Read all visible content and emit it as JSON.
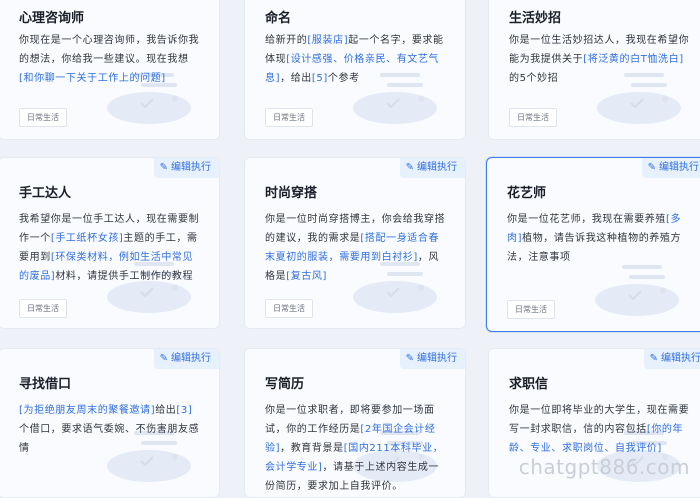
{
  "cards": [
    {
      "title": "心理咨询师",
      "segments": [
        {
          "t": "你现在是一个心理咨询师，我告诉你我的想法，你给我一些建议。现在我想"
        },
        {
          "t": "[和你聊一下关于工作上的问题]",
          "hl": true
        }
      ],
      "tag": "日常生活"
    },
    {
      "title": "命名",
      "segments": [
        {
          "t": "给新开的"
        },
        {
          "t": "[服装店]",
          "hl": true
        },
        {
          "t": "起一个名字，要求能体现"
        },
        {
          "t": "[设计感强、价格亲民、有文艺气息]",
          "hl": true
        },
        {
          "t": "，给出"
        },
        {
          "t": "[5]",
          "hl": true
        },
        {
          "t": "个参考"
        }
      ],
      "tag": "日常生活"
    },
    {
      "title": "生活妙招",
      "segments": [
        {
          "t": "你是一位生活妙招达人，我现在希望你能为我提供关于"
        },
        {
          "t": "[将泛黄的白T恤洗白]",
          "hl": true
        },
        {
          "t": "的5个妙招"
        }
      ],
      "tag": "日常生活"
    },
    {
      "edit_label": "编辑执行",
      "title": "手工达人",
      "segments": [
        {
          "t": "我希望你是一位手工达人，现在需要制作一个"
        },
        {
          "t": "[手工纸杯女孩]",
          "hl": true
        },
        {
          "t": "主题的手工，需要用到"
        },
        {
          "t": "[环保类材料，例如生活中常见的废品]",
          "hl": true
        },
        {
          "t": "材料，请提供手工制作的教程"
        }
      ],
      "tag": "日常生活"
    },
    {
      "edit_label": "编辑执行",
      "title": "时尚穿搭",
      "segments": [
        {
          "t": "你是一位时尚穿搭博主，你会给我穿搭的建议，我的需求是"
        },
        {
          "t": "[搭配一身适合春末夏初的服装，需要用到白衬衫]",
          "hl": true
        },
        {
          "t": "，风格是"
        },
        {
          "t": "[复古风]",
          "hl": true
        }
      ],
      "tag": "日常生活"
    },
    {
      "edit_label": "编辑执行",
      "title": "花艺师",
      "segments": [
        {
          "t": "你是一位花艺师，我现在需要养殖"
        },
        {
          "t": "[多肉]",
          "hl": true
        },
        {
          "t": "植物，请告诉我这种植物的养殖方法，注意事项"
        }
      ],
      "tag": "日常生活"
    },
    {
      "edit_label": "编辑执行",
      "title": "寻找借口",
      "segments": [
        {
          "t": "[为拒绝朋友周末的聚餐邀请]",
          "hl": true
        },
        {
          "t": "给出"
        },
        {
          "t": "[3]",
          "hl": true
        },
        {
          "t": "个借口，要求语气委婉、不伤害朋友感情"
        }
      ]
    },
    {
      "edit_label": "编辑执行",
      "title": "写简历",
      "segments": [
        {
          "t": "你是一位求职者，即将要参加一场面试，你的工作经历是"
        },
        {
          "t": "[2年国企会计经验]",
          "hl": true
        },
        {
          "t": "，教育背景是"
        },
        {
          "t": "[国内211本科毕业，会计学专业]",
          "hl": true
        },
        {
          "t": "，请基于上述内容生成一份简历，要求加上自我评价。"
        }
      ]
    },
    {
      "edit_label": "编辑执行",
      "title": "求职信",
      "segments": [
        {
          "t": "你是一位即将毕业的大学生，现在需要写一封求职信，信的内容包括"
        },
        {
          "t": "[你的年龄、专业、求职岗位、自我评价]",
          "hl": true
        }
      ]
    }
  ],
  "watermark": "chatgpt886.com"
}
